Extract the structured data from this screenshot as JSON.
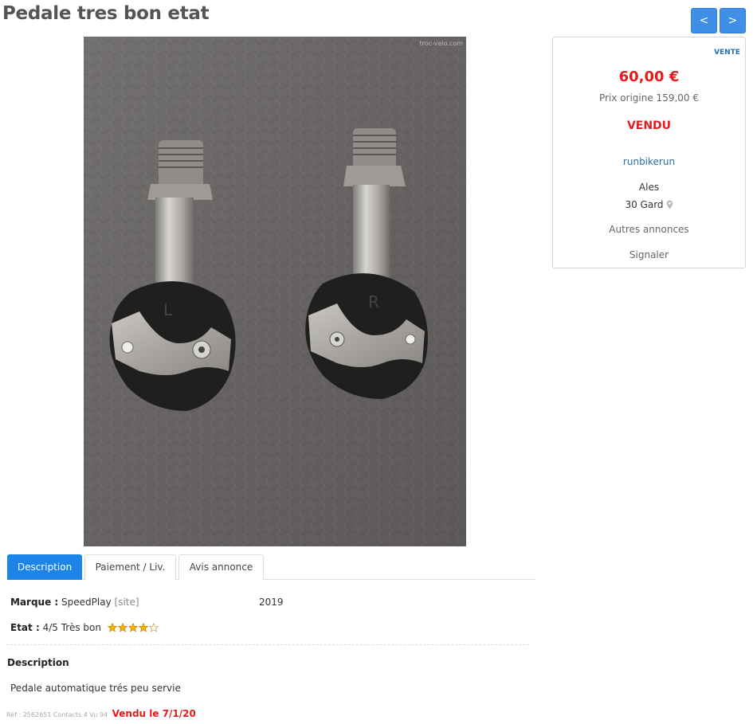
{
  "listing": {
    "title": "Pedale tres bon etat",
    "nav": {
      "prev_label": "<",
      "next_label": ">"
    },
    "photo_watermark": "troc-velo.com"
  },
  "card": {
    "type_badge": "VENTE",
    "price": "60,00 €",
    "original_price": "Prix origine 159,00 €",
    "status": "VENDU",
    "seller": "runbikerun",
    "city": "Ales",
    "department": "30 Gard",
    "other_listings": "Autres annonces",
    "report": "Signaler"
  },
  "tabs": [
    {
      "label": "Description",
      "active": true
    },
    {
      "label": "Paiement / Liv.",
      "active": false
    },
    {
      "label": "Avis annonce",
      "active": false
    }
  ],
  "specs": {
    "brand_label": "Marque :",
    "brand_value": "SpeedPlay",
    "brand_site": "[site]",
    "year": "2019",
    "condition_label": "Etat :",
    "condition_value": "4/5 Très bon",
    "rating": 4,
    "rating_max": 5
  },
  "description": {
    "heading": "Description",
    "text": "Pedale automatique trés peu servie"
  },
  "footer": {
    "meta": "Réf : 2562651 Contacts 4 Vu 94",
    "sold_date": "Vendu le 7/1/20"
  },
  "colors": {
    "accent_blue": "#1a84e8",
    "price_red": "#e41c1c",
    "link_blue": "#2a6fa8",
    "star_gold": "#f4b400"
  },
  "icons": [
    "map-pin-icon",
    "star-icon"
  ]
}
